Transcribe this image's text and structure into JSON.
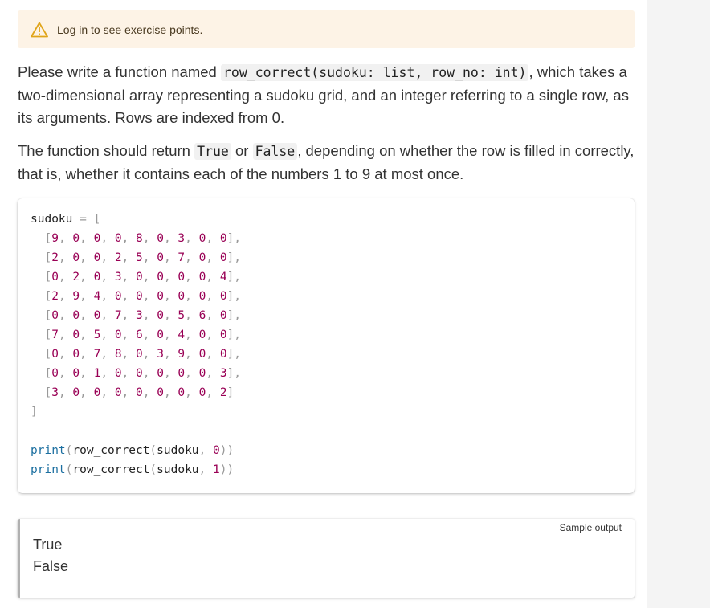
{
  "alert": {
    "icon": "warning-triangle-icon",
    "icon_color": "#e0a419",
    "text": "Log in to see exercise points."
  },
  "intro": {
    "p1_a": "Please write a function named ",
    "p1_code": "row_correct(sudoku: list, row_no: int)",
    "p1_b": ", which takes a two-dimensional array representing a sudoku grid, and an integer referring to a single row, as its arguments. Rows are indexed from 0.",
    "p2_a": "The function should return ",
    "p2_code1": "True",
    "p2_b": " or ",
    "p2_code2": "False",
    "p2_c": ", depending on whether the row is filled in correctly, that is, whether it contains each of the numbers 1 to 9 at most once."
  },
  "code": {
    "var_name": "sudoku",
    "assign": " = [",
    "rows": [
      [
        9,
        0,
        0,
        0,
        8,
        0,
        3,
        0,
        0
      ],
      [
        2,
        0,
        0,
        2,
        5,
        0,
        7,
        0,
        0
      ],
      [
        0,
        2,
        0,
        3,
        0,
        0,
        0,
        0,
        4
      ],
      [
        2,
        9,
        4,
        0,
        0,
        0,
        0,
        0,
        0
      ],
      [
        0,
        0,
        0,
        7,
        3,
        0,
        5,
        6,
        0
      ],
      [
        7,
        0,
        5,
        0,
        6,
        0,
        4,
        0,
        0
      ],
      [
        0,
        0,
        7,
        8,
        0,
        3,
        9,
        0,
        0
      ],
      [
        0,
        0,
        1,
        0,
        0,
        0,
        0,
        0,
        3
      ],
      [
        3,
        0,
        0,
        0,
        0,
        0,
        0,
        0,
        2
      ]
    ],
    "close": "]",
    "calls": [
      {
        "fn": "print",
        "inner": "row_correct",
        "arg": "sudoku",
        "num": "0"
      },
      {
        "fn": "print",
        "inner": "row_correct",
        "arg": "sudoku",
        "num": "1"
      }
    ]
  },
  "output": {
    "label": "Sample output",
    "lines": [
      "True",
      "False"
    ]
  }
}
